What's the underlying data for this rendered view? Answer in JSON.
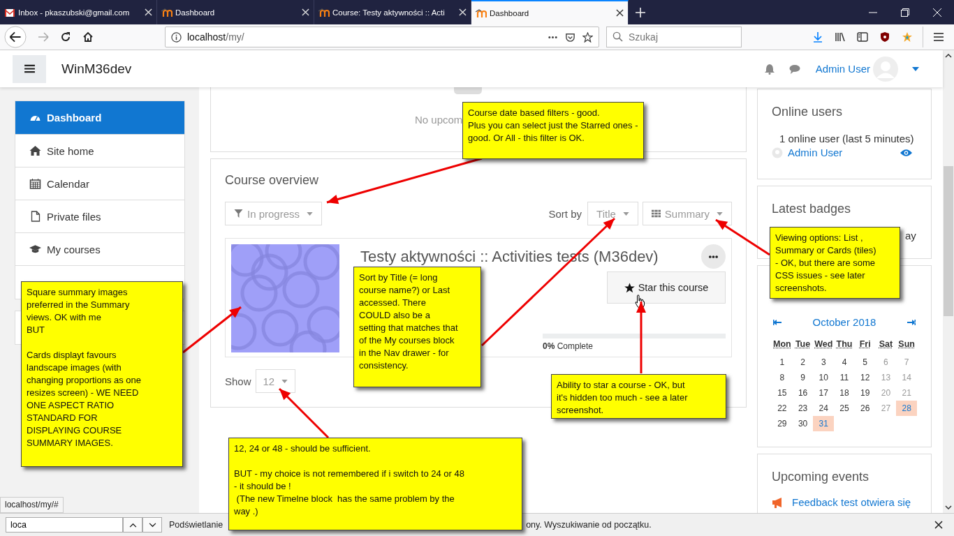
{
  "browser": {
    "tabs": [
      {
        "title": "Inbox - pkaszubski@gmail.com",
        "selected": false
      },
      {
        "title": "Dashboard",
        "selected": false
      },
      {
        "title": "Course: Testy aktywności :: Acti",
        "selected": false
      },
      {
        "title": "Dashboard",
        "selected": true
      }
    ],
    "address": {
      "host": "localhost",
      "path": "/my/"
    },
    "search": {
      "placeholder": "Szukaj"
    }
  },
  "navbar": {
    "site_name": "WinM36dev",
    "user_name": "Admin User"
  },
  "nav_drawer": {
    "items": [
      {
        "label": "Dashboard",
        "selected": true
      },
      {
        "label": "Site home",
        "selected": false
      },
      {
        "label": "Calendar",
        "selected": false
      },
      {
        "label": "Private files",
        "selected": false
      },
      {
        "label": "My courses",
        "selected": false
      }
    ]
  },
  "timeline_card": {
    "empty_text": "No upcom"
  },
  "course_overview": {
    "title": "Course overview",
    "filter": "In progress",
    "sort_label": "Sort by",
    "sort": "Title",
    "view": "Summary",
    "courses": [
      {
        "name": "Testy aktywności :: Activities tests (M36dev)",
        "star_label": "Star this course",
        "progress": {
          "level": 0,
          "percent": "0%",
          "label": "Complete"
        }
      }
    ],
    "show_label": "Show",
    "show_count": "12"
  },
  "online_users": {
    "title": "Online users",
    "summary": "1 online user (last 5 minutes)",
    "users": [
      "Admin User"
    ]
  },
  "latest_badges": {
    "title": "Latest badges",
    "text": "ay"
  },
  "calendar": {
    "month": "October 2018",
    "weekdays": [
      "Mon",
      "Tue",
      "Wed",
      "Thu",
      "Fri",
      "Sat",
      "Sun"
    ],
    "days": [
      {
        "day": "1",
        "weekend": false,
        "highlighted": false
      },
      {
        "day": "2",
        "weekend": false,
        "highlighted": false
      },
      {
        "day": "3",
        "weekend": false,
        "highlighted": false
      },
      {
        "day": "4",
        "weekend": false,
        "highlighted": false
      },
      {
        "day": "5",
        "weekend": false,
        "highlighted": false
      },
      {
        "day": "6",
        "weekend": true,
        "highlighted": false
      },
      {
        "day": "7",
        "weekend": true,
        "highlighted": false
      },
      {
        "day": "8",
        "weekend": false,
        "highlighted": false
      },
      {
        "day": "9",
        "weekend": false,
        "highlighted": false
      },
      {
        "day": "10",
        "weekend": false,
        "highlighted": false
      },
      {
        "day": "11",
        "weekend": false,
        "highlighted": false
      },
      {
        "day": "12",
        "weekend": false,
        "highlighted": false
      },
      {
        "day": "13",
        "weekend": true,
        "highlighted": false
      },
      {
        "day": "14",
        "weekend": true,
        "highlighted": false
      },
      {
        "day": "15",
        "weekend": false,
        "highlighted": false
      },
      {
        "day": "16",
        "weekend": false,
        "highlighted": false
      },
      {
        "day": "17",
        "weekend": false,
        "highlighted": false
      },
      {
        "day": "18",
        "weekend": false,
        "highlighted": false
      },
      {
        "day": "19",
        "weekend": false,
        "highlighted": false
      },
      {
        "day": "20",
        "weekend": true,
        "highlighted": false
      },
      {
        "day": "21",
        "weekend": true,
        "highlighted": false
      },
      {
        "day": "22",
        "weekend": false,
        "highlighted": false
      },
      {
        "day": "23",
        "weekend": false,
        "highlighted": false
      },
      {
        "day": "24",
        "weekend": false,
        "highlighted": false
      },
      {
        "day": "25",
        "weekend": false,
        "highlighted": false
      },
      {
        "day": "26",
        "weekend": false,
        "highlighted": false
      },
      {
        "day": "27",
        "weekend": true,
        "highlighted": false
      },
      {
        "day": "28",
        "weekend": true,
        "highlighted": true
      },
      {
        "day": "29",
        "weekend": false,
        "highlighted": false
      },
      {
        "day": "30",
        "weekend": false,
        "highlighted": false
      },
      {
        "day": "31",
        "weekend": false,
        "highlighted": true
      }
    ]
  },
  "upcoming_events": {
    "title": "Upcoming events",
    "events": [
      "Feedback test otwiera się"
    ]
  },
  "status_link": "localhost/my/#",
  "find_bar": {
    "query": "loca",
    "message_start": "Podświetlanie",
    "message_end": "ony. Wyszukiwanie od początku."
  },
  "annotations": [
    {
      "paragraphs": [
        [
          "Course date based filters - good.",
          "Plus you can select just the Starred ones -",
          "good. Or All - this filter is OK."
        ]
      ]
    },
    {
      "paragraphs": [
        [
          "Square summary images",
          "preferred in the Summary",
          "views. OK with me",
          "BUT"
        ],
        [
          "Cards displayt favours",
          "landscape images (with",
          "changing proportions as one",
          "resizes screen) - WE NEED",
          "ONE ASPECT RATIO",
          "STANDARD FOR",
          "DISPLAYING COURSE",
          "SUMMARY IMAGES."
        ]
      ]
    },
    {
      "paragraphs": [
        [
          "Sort by Title (= long",
          "course name?) or Last",
          "accessed. There",
          "COULD also be a",
          "setting that matches that",
          "of the My courses block",
          "in the Nav drawer - for",
          "consistency."
        ]
      ]
    },
    {
      "paragraphs": [
        [
          "Viewing options: List ,",
          "Summary or Cards (tiles)",
          "- OK, but there are some",
          "CSS issues - see later",
          "screenshots."
        ]
      ]
    },
    {
      "paragraphs": [
        [
          "Ability to star a course - OK, but",
          "it's hidden too much - see a later",
          "screenshot."
        ]
      ]
    },
    {
      "paragraphs": [
        [
          "12, 24 or 48 - should be sufficient."
        ],
        [
          "BUT - my choice is not remembered if i switch to 24 or 48",
          "- it should be !",
          " (The new Timelne block  has the same problem by the",
          "way .)"
        ]
      ]
    }
  ]
}
